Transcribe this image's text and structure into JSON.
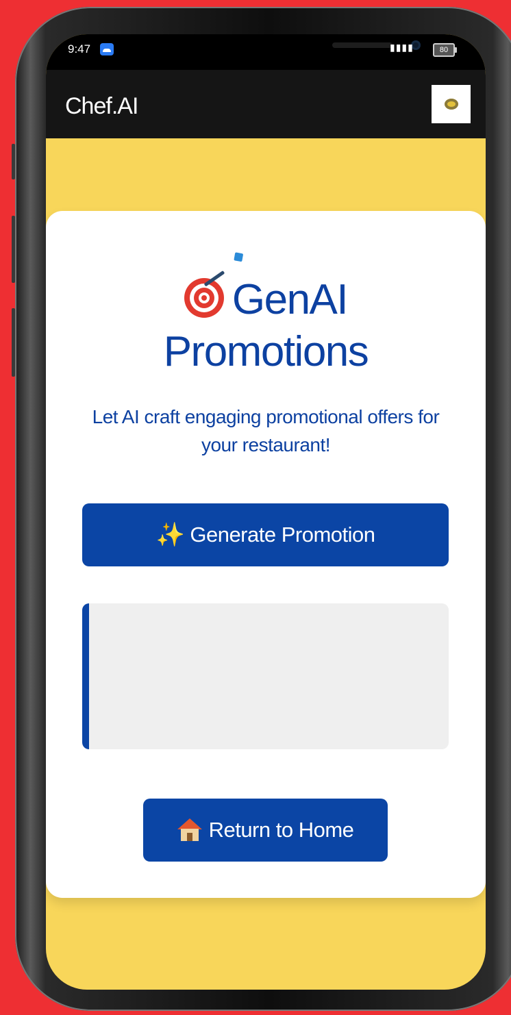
{
  "status_bar": {
    "time": "9:47",
    "signal": "²⁵ᴳ∂┃",
    "battery": "80"
  },
  "app_bar": {
    "title": "Chef.AI"
  },
  "card": {
    "title_line1": "GenAI",
    "title_line2": "Promotions",
    "title_icon": "target-icon",
    "subtitle": "Let AI craft engaging promotional offers for your restaurant!",
    "generate_button": {
      "icon": "sparkles-icon",
      "label": "Generate Promotion"
    },
    "output_text": "",
    "home_button": {
      "icon": "house-icon",
      "label": "Return to Home"
    }
  },
  "colors": {
    "background": "#ee2f33",
    "screen_background": "#f8d65a",
    "app_bar": "#151515",
    "primary": "#0b45a5",
    "heading_text": "#0d41a1",
    "output_box": "#efefef"
  }
}
